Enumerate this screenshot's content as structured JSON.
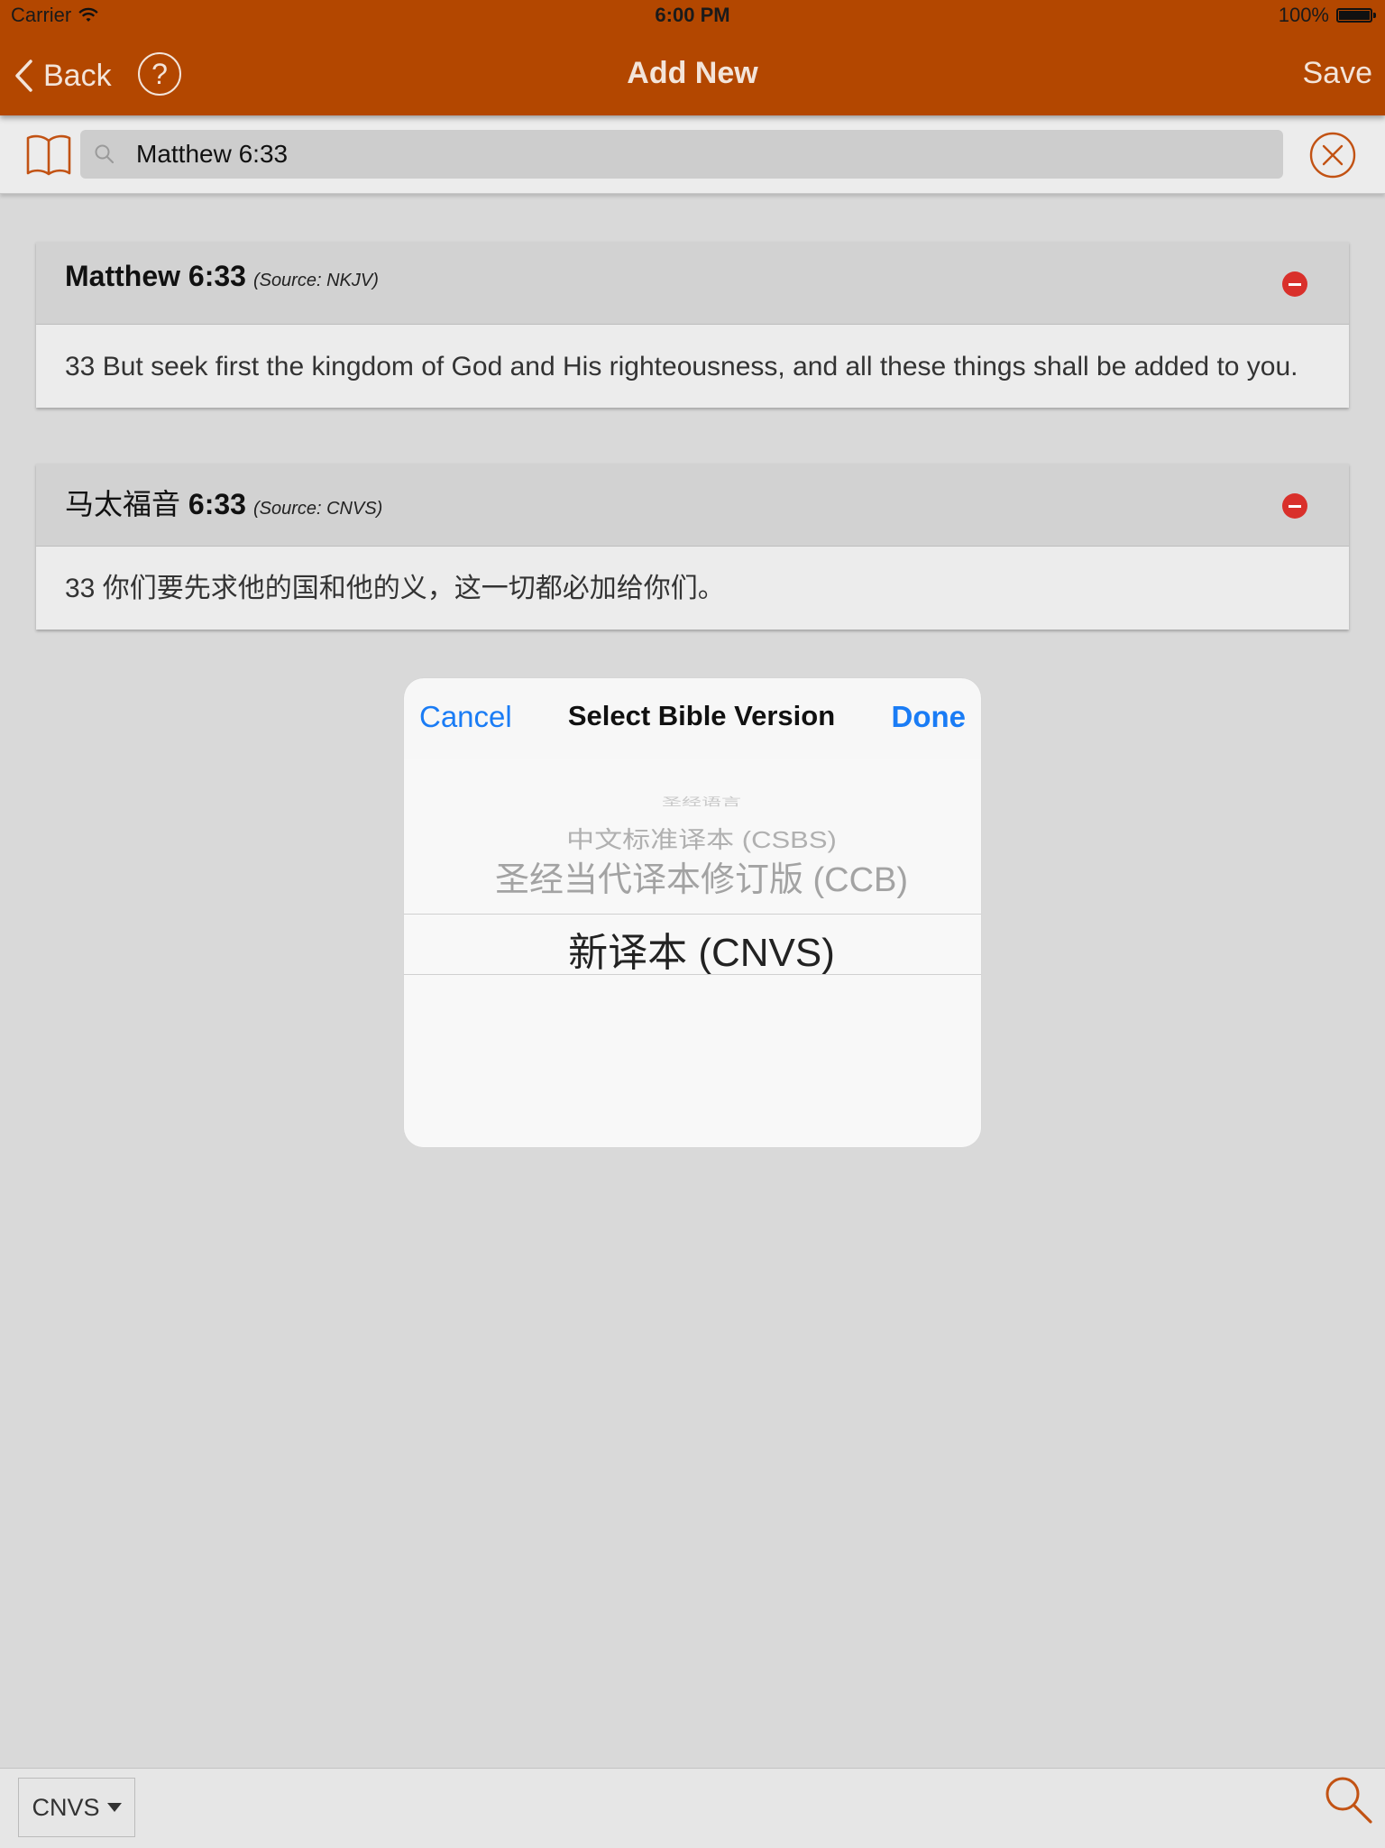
{
  "status_bar": {
    "carrier": "Carrier",
    "time": "6:00 PM",
    "battery": "100%"
  },
  "nav": {
    "back_label": "Back",
    "help_label": "?",
    "title": "Add New",
    "save_label": "Save"
  },
  "search": {
    "value": "Matthew 6:33",
    "placeholder": ""
  },
  "verses": [
    {
      "ref_name": "",
      "ref_bold": "Matthew 6:33",
      "source": "(Source: NKJV)",
      "text": "33 But seek first the kingdom of God and His righteousness, and all these things shall be added to you."
    },
    {
      "ref_name": "马太福音",
      "ref_bold": "6:33",
      "source": "(Source: CNVS)",
      "text": "33 你们要先求他的国和他的义，这一切都必加给你们。"
    }
  ],
  "picker_dialog": {
    "cancel_label": "Cancel",
    "title": "Select Bible Version",
    "done_label": "Done",
    "options": [
      "圣经语言",
      "中文标准译本 (CSBS)",
      "圣经当代译本修订版 (CCB)",
      "新译本 (CNVS)"
    ],
    "selected": "新译本 (CNVS)"
  },
  "bottom_bar": {
    "version_label": "CNVS"
  },
  "colors": {
    "nav_background": "#b34700",
    "accent_orange": "#c25213",
    "link_blue": "#1a7cf5",
    "remove_red": "#d9302b"
  },
  "icons": {
    "back": "chevron-left-icon",
    "help": "question-circle-icon",
    "book": "open-book-icon",
    "search": "magnifier-icon",
    "clear": "close-circle-icon",
    "remove": "minus-circle-icon",
    "version_caret": "caret-down-icon"
  }
}
